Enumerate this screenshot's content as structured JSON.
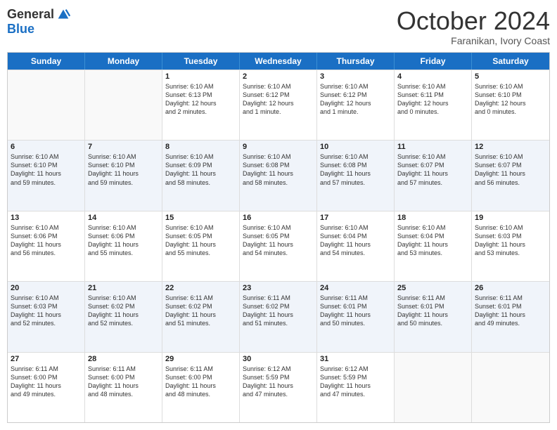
{
  "logo": {
    "general": "General",
    "blue": "Blue"
  },
  "header": {
    "month": "October 2024",
    "location": "Faranikan, Ivory Coast"
  },
  "days": [
    "Sunday",
    "Monday",
    "Tuesday",
    "Wednesday",
    "Thursday",
    "Friday",
    "Saturday"
  ],
  "weeks": [
    [
      {
        "day": "",
        "empty": true
      },
      {
        "day": "",
        "empty": true
      },
      {
        "day": "1",
        "line1": "Sunrise: 6:10 AM",
        "line2": "Sunset: 6:13 PM",
        "line3": "Daylight: 12 hours",
        "line4": "and 2 minutes."
      },
      {
        "day": "2",
        "line1": "Sunrise: 6:10 AM",
        "line2": "Sunset: 6:12 PM",
        "line3": "Daylight: 12 hours",
        "line4": "and 1 minute."
      },
      {
        "day": "3",
        "line1": "Sunrise: 6:10 AM",
        "line2": "Sunset: 6:12 PM",
        "line3": "Daylight: 12 hours",
        "line4": "and 1 minute."
      },
      {
        "day": "4",
        "line1": "Sunrise: 6:10 AM",
        "line2": "Sunset: 6:11 PM",
        "line3": "Daylight: 12 hours",
        "line4": "and 0 minutes."
      },
      {
        "day": "5",
        "line1": "Sunrise: 6:10 AM",
        "line2": "Sunset: 6:10 PM",
        "line3": "Daylight: 12 hours",
        "line4": "and 0 minutes."
      }
    ],
    [
      {
        "day": "6",
        "line1": "Sunrise: 6:10 AM",
        "line2": "Sunset: 6:10 PM",
        "line3": "Daylight: 11 hours",
        "line4": "and 59 minutes."
      },
      {
        "day": "7",
        "line1": "Sunrise: 6:10 AM",
        "line2": "Sunset: 6:10 PM",
        "line3": "Daylight: 11 hours",
        "line4": "and 59 minutes."
      },
      {
        "day": "8",
        "line1": "Sunrise: 6:10 AM",
        "line2": "Sunset: 6:09 PM",
        "line3": "Daylight: 11 hours",
        "line4": "and 58 minutes."
      },
      {
        "day": "9",
        "line1": "Sunrise: 6:10 AM",
        "line2": "Sunset: 6:08 PM",
        "line3": "Daylight: 11 hours",
        "line4": "and 58 minutes."
      },
      {
        "day": "10",
        "line1": "Sunrise: 6:10 AM",
        "line2": "Sunset: 6:08 PM",
        "line3": "Daylight: 11 hours",
        "line4": "and 57 minutes."
      },
      {
        "day": "11",
        "line1": "Sunrise: 6:10 AM",
        "line2": "Sunset: 6:07 PM",
        "line3": "Daylight: 11 hours",
        "line4": "and 57 minutes."
      },
      {
        "day": "12",
        "line1": "Sunrise: 6:10 AM",
        "line2": "Sunset: 6:07 PM",
        "line3": "Daylight: 11 hours",
        "line4": "and 56 minutes."
      }
    ],
    [
      {
        "day": "13",
        "line1": "Sunrise: 6:10 AM",
        "line2": "Sunset: 6:06 PM",
        "line3": "Daylight: 11 hours",
        "line4": "and 56 minutes."
      },
      {
        "day": "14",
        "line1": "Sunrise: 6:10 AM",
        "line2": "Sunset: 6:06 PM",
        "line3": "Daylight: 11 hours",
        "line4": "and 55 minutes."
      },
      {
        "day": "15",
        "line1": "Sunrise: 6:10 AM",
        "line2": "Sunset: 6:05 PM",
        "line3": "Daylight: 11 hours",
        "line4": "and 55 minutes."
      },
      {
        "day": "16",
        "line1": "Sunrise: 6:10 AM",
        "line2": "Sunset: 6:05 PM",
        "line3": "Daylight: 11 hours",
        "line4": "and 54 minutes."
      },
      {
        "day": "17",
        "line1": "Sunrise: 6:10 AM",
        "line2": "Sunset: 6:04 PM",
        "line3": "Daylight: 11 hours",
        "line4": "and 54 minutes."
      },
      {
        "day": "18",
        "line1": "Sunrise: 6:10 AM",
        "line2": "Sunset: 6:04 PM",
        "line3": "Daylight: 11 hours",
        "line4": "and 53 minutes."
      },
      {
        "day": "19",
        "line1": "Sunrise: 6:10 AM",
        "line2": "Sunset: 6:03 PM",
        "line3": "Daylight: 11 hours",
        "line4": "and 53 minutes."
      }
    ],
    [
      {
        "day": "20",
        "line1": "Sunrise: 6:10 AM",
        "line2": "Sunset: 6:03 PM",
        "line3": "Daylight: 11 hours",
        "line4": "and 52 minutes."
      },
      {
        "day": "21",
        "line1": "Sunrise: 6:10 AM",
        "line2": "Sunset: 6:02 PM",
        "line3": "Daylight: 11 hours",
        "line4": "and 52 minutes."
      },
      {
        "day": "22",
        "line1": "Sunrise: 6:11 AM",
        "line2": "Sunset: 6:02 PM",
        "line3": "Daylight: 11 hours",
        "line4": "and 51 minutes."
      },
      {
        "day": "23",
        "line1": "Sunrise: 6:11 AM",
        "line2": "Sunset: 6:02 PM",
        "line3": "Daylight: 11 hours",
        "line4": "and 51 minutes."
      },
      {
        "day": "24",
        "line1": "Sunrise: 6:11 AM",
        "line2": "Sunset: 6:01 PM",
        "line3": "Daylight: 11 hours",
        "line4": "and 50 minutes."
      },
      {
        "day": "25",
        "line1": "Sunrise: 6:11 AM",
        "line2": "Sunset: 6:01 PM",
        "line3": "Daylight: 11 hours",
        "line4": "and 50 minutes."
      },
      {
        "day": "26",
        "line1": "Sunrise: 6:11 AM",
        "line2": "Sunset: 6:01 PM",
        "line3": "Daylight: 11 hours",
        "line4": "and 49 minutes."
      }
    ],
    [
      {
        "day": "27",
        "line1": "Sunrise: 6:11 AM",
        "line2": "Sunset: 6:00 PM",
        "line3": "Daylight: 11 hours",
        "line4": "and 49 minutes."
      },
      {
        "day": "28",
        "line1": "Sunrise: 6:11 AM",
        "line2": "Sunset: 6:00 PM",
        "line3": "Daylight: 11 hours",
        "line4": "and 48 minutes."
      },
      {
        "day": "29",
        "line1": "Sunrise: 6:11 AM",
        "line2": "Sunset: 6:00 PM",
        "line3": "Daylight: 11 hours",
        "line4": "and 48 minutes."
      },
      {
        "day": "30",
        "line1": "Sunrise: 6:12 AM",
        "line2": "Sunset: 5:59 PM",
        "line3": "Daylight: 11 hours",
        "line4": "and 47 minutes."
      },
      {
        "day": "31",
        "line1": "Sunrise: 6:12 AM",
        "line2": "Sunset: 5:59 PM",
        "line3": "Daylight: 11 hours",
        "line4": "and 47 minutes."
      },
      {
        "day": "",
        "empty": true
      },
      {
        "day": "",
        "empty": true
      }
    ]
  ]
}
